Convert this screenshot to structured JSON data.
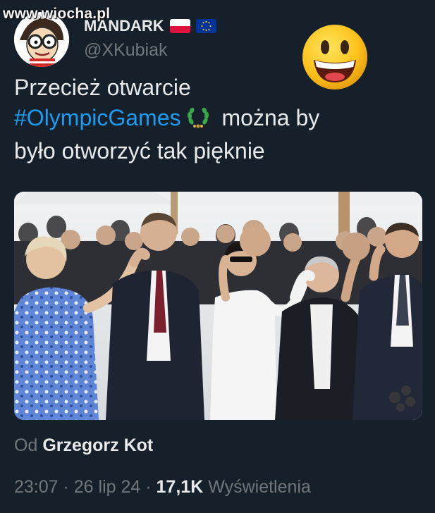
{
  "watermark": {
    "text": "www.wiocha.pl"
  },
  "author": {
    "display_name": "MANDARK",
    "handle": "@XKubiak",
    "flags": [
      "poland-flag",
      "eu-flag"
    ]
  },
  "decoration": {
    "emoji": "grinning-face-emoji"
  },
  "tweet": {
    "line1": "Przecież otwarcie",
    "hashtag": "#OlympicGames",
    "hashtag_icon": "olympic-wreath-icon",
    "line2_rest": "można by",
    "line3": "było otworzyć tak pięknie"
  },
  "media": {
    "content": "video-still-people-holding-hands"
  },
  "attribution": {
    "prefix": "Od",
    "name": "Grzegorz Kot"
  },
  "meta": {
    "time": "23:07",
    "sep1": " · ",
    "date": "26 lip 24",
    "sep2": " · ",
    "views": "17,1K",
    "views_label": "Wyświetlenia"
  },
  "colors": {
    "background": "#15202b",
    "text": "#e7e9ea",
    "muted": "#71767b",
    "link": "#1d9bf0"
  }
}
